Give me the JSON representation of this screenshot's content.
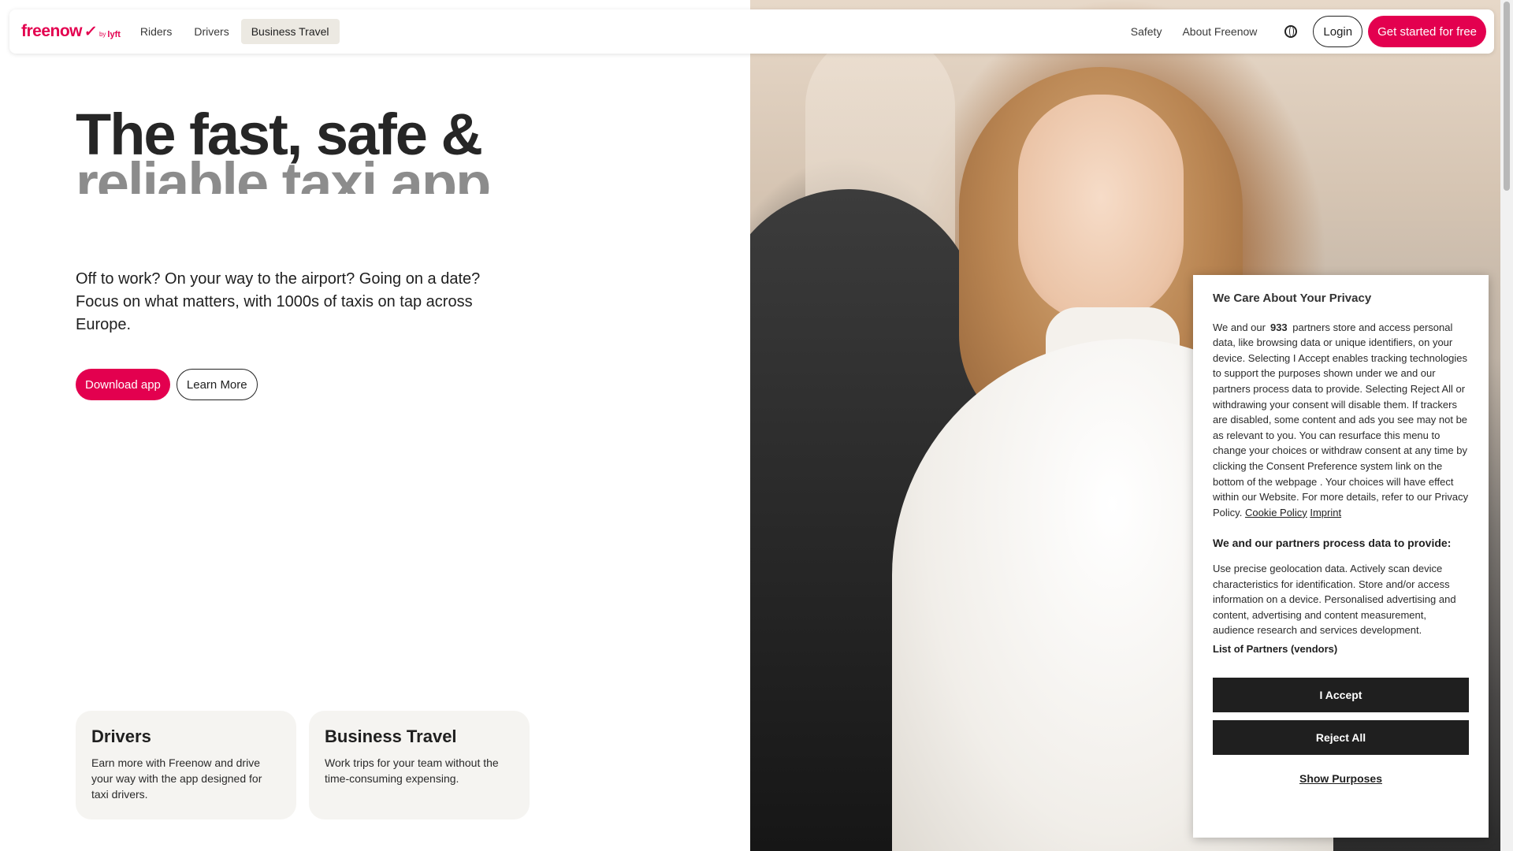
{
  "header": {
    "logo_word": "freenow",
    "logo_by": "by",
    "logo_lyft": "lyft",
    "nav": [
      "Riders",
      "Drivers",
      "Business Travel"
    ],
    "active_nav": "Business Travel",
    "right_links": [
      "Safety",
      "About Freenow"
    ],
    "language_icon": "globe-icon",
    "login": "Login",
    "get_started": "Get started for free"
  },
  "hero": {
    "title_line1": "The fast, safe &",
    "title_line2": "reliable taxi app",
    "subtitle": "Off to work? On your way to the airport? Going on a date? Focus on what matters, with 1000s of taxis on tap across Europe.",
    "download": "Download app",
    "learn_more": "Learn More"
  },
  "cards": [
    {
      "title": "Drivers",
      "text": "Earn more with Freenow and drive your way with the app designed for taxi drivers."
    },
    {
      "title": "Business Travel",
      "text": "Work trips for your team without the time-consuming expensing."
    }
  ],
  "consent": {
    "title": "We Care About Your Privacy",
    "intro_prefix": "We and our",
    "partner_count": "933",
    "intro_body": "partners store and access personal data, like browsing data or unique identifiers, on your device. Selecting I Accept enables tracking technologies to support the purposes shown under we and our partners process data to provide. Selecting Reject All or withdrawing your consent will disable them. If trackers are disabled, some content and ads you see may not be as relevant to you. You can resurface this menu to change your choices or withdraw consent at any time by clicking the Consent Preference system link on the bottom of the webpage . Your choices will have effect within our Website. For more details, refer to our Privacy Policy.",
    "cookie_policy": "Cookie Policy",
    "imprint": "Imprint",
    "purposes_heading": "We and our partners process data to provide:",
    "purposes_text": "Use precise geolocation data. Actively scan device characteristics for identification. Store and/or access information on a device. Personalised advertising and content, advertising and content measurement, audience research and services development.",
    "vendors_link": "List of Partners (vendors)",
    "accept": "I Accept",
    "reject": "Reject All",
    "show_purposes": "Show Purposes"
  },
  "colors": {
    "brand": "#e3004f",
    "dark_button": "#1f1f1f",
    "active_nav_bg": "#ece9e2",
    "card_bg": "#f5f4f1"
  }
}
